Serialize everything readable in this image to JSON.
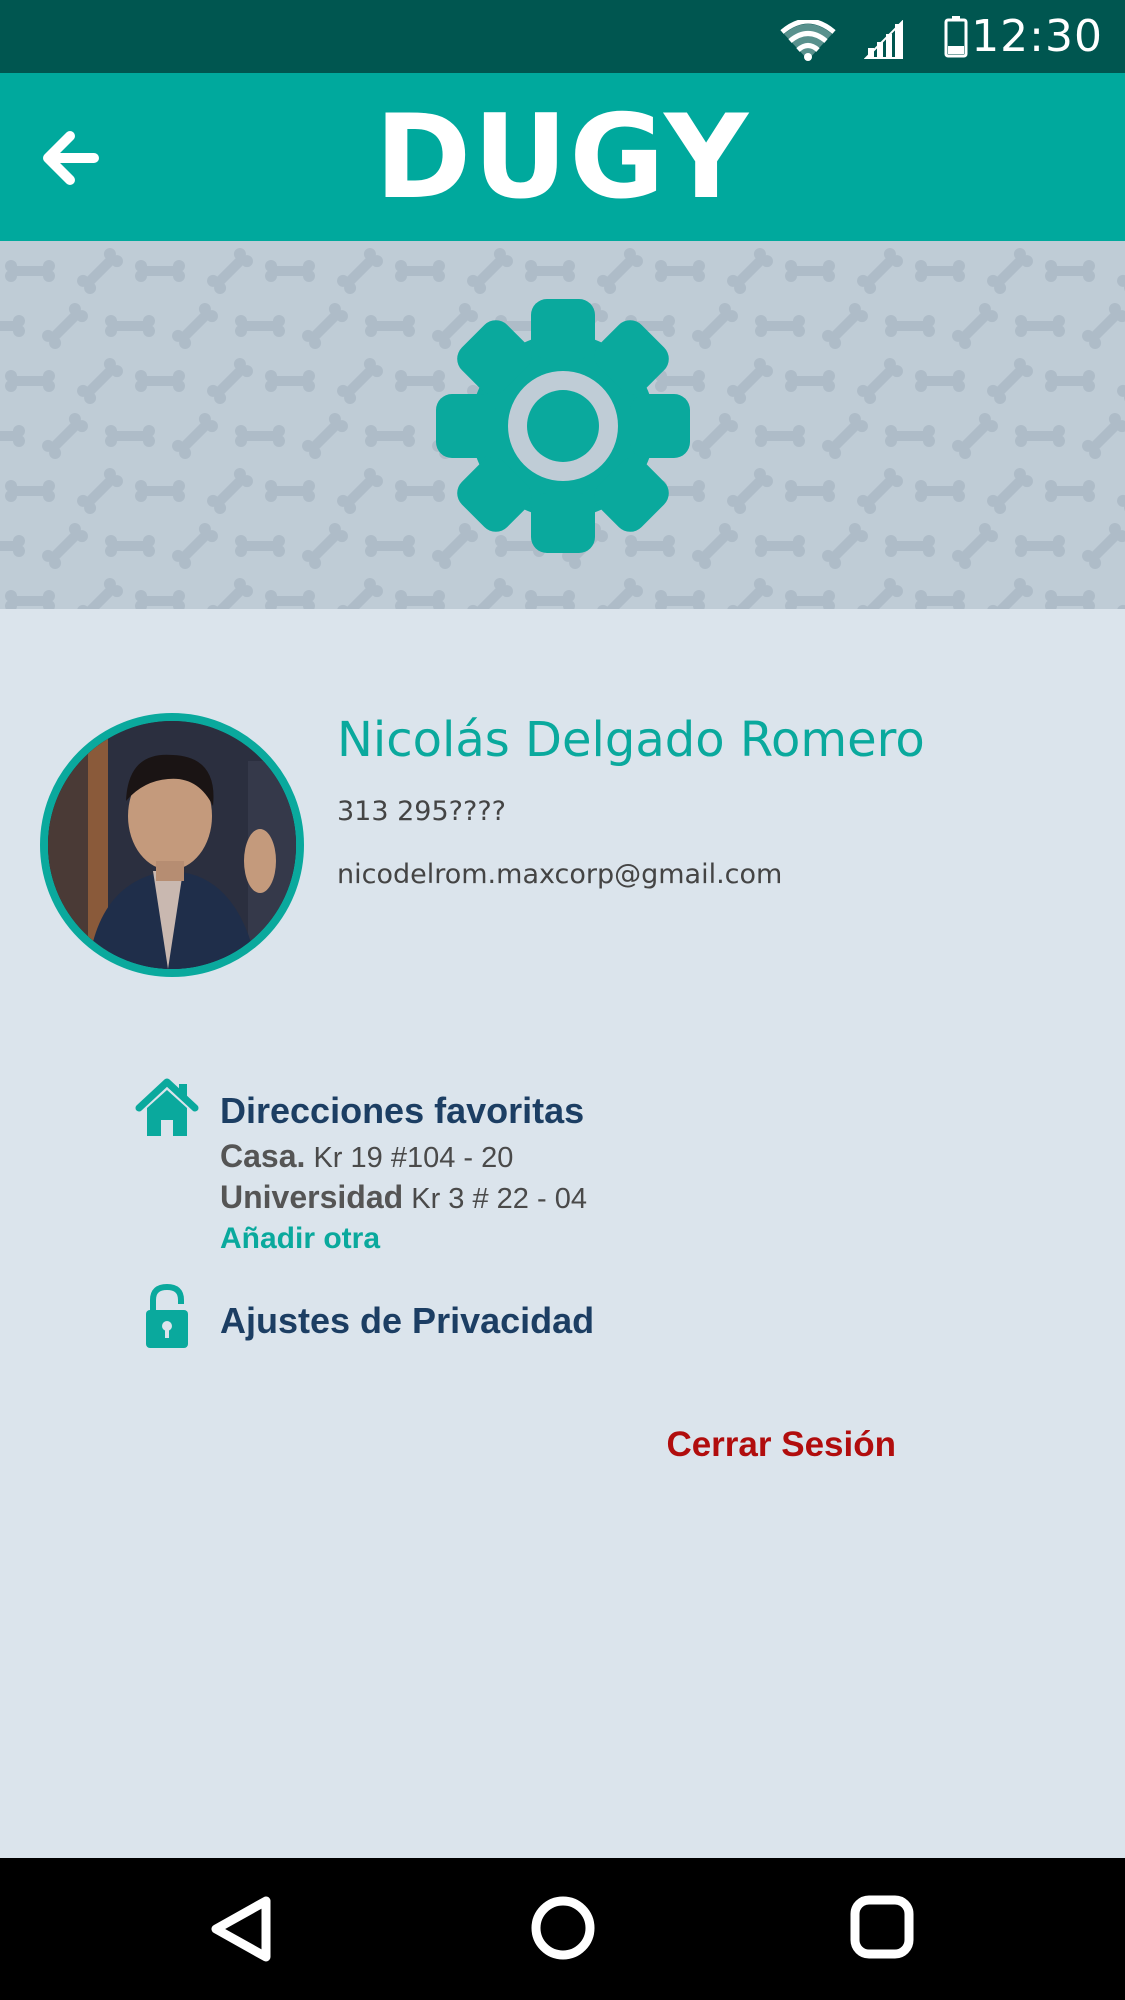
{
  "status_bar": {
    "time": "12:30"
  },
  "app_bar": {
    "logo": "DUGY"
  },
  "profile": {
    "name": "Nicolás Delgado Romero",
    "phone": "313 295????",
    "email": "nicodelrom.maxcorp@gmail.com"
  },
  "favorites": {
    "title": "Direcciones favoritas",
    "items": [
      {
        "label": "Casa.",
        "address": "Kr 19 #104 - 20"
      },
      {
        "label": "Universidad",
        "address": "Kr 3 # 22 - 04"
      }
    ],
    "add_label": "Añadir otra"
  },
  "privacy": {
    "title": "Ajustes de Privacidad"
  },
  "logout_label": "Cerrar Sesión",
  "colors": {
    "accent": "#00a99d",
    "status_bar": "#005650",
    "title_blue": "#1c3e63",
    "logout_red": "#b10d0d"
  }
}
